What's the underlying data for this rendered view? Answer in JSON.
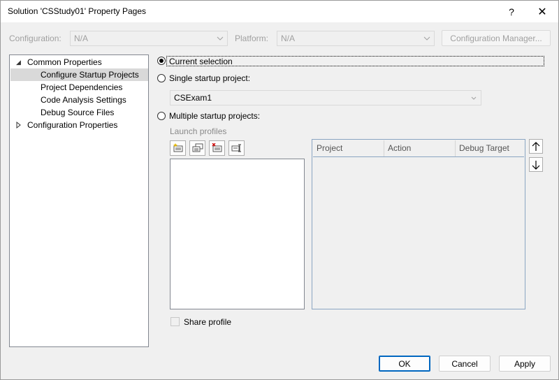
{
  "window": {
    "title": "Solution 'CSStudy01' Property Pages",
    "help_label": "?",
    "close_label": "✕"
  },
  "config_bar": {
    "configuration_label": "Configuration:",
    "configuration_value": "N/A",
    "platform_label": "Platform:",
    "platform_value": "N/A",
    "config_manager_label": "Configuration Manager..."
  },
  "tree": {
    "common_properties": "Common Properties",
    "items": [
      "Configure Startup Projects",
      "Project Dependencies",
      "Code Analysis Settings",
      "Debug Source Files"
    ],
    "configuration_properties": "Configuration Properties",
    "selected": "Configure Startup Projects"
  },
  "startup": {
    "current_selection_label": "Current selection",
    "single_startup_label": "Single startup project:",
    "single_startup_value": "CSExam1",
    "multiple_startup_label": "Multiple startup projects:",
    "launch_profiles_label": "Launch profiles",
    "selected_option": "Current selection",
    "profile_buttons": [
      "new-profile-icon",
      "copy-profile-icon",
      "delete-profile-icon",
      "rename-profile-icon"
    ],
    "columns": [
      "Project",
      "Action",
      "Debug Target"
    ],
    "move_up_icon": "arrow-up-icon",
    "move_down_icon": "arrow-down-icon",
    "share_profile_label": "Share profile"
  },
  "footer": {
    "ok_label": "OK",
    "cancel_label": "Cancel",
    "apply_label": "Apply"
  },
  "colors": {
    "accent": "#0067c0",
    "selection_bg": "#d9d9d9",
    "disabled_text": "#a0a0a0"
  }
}
